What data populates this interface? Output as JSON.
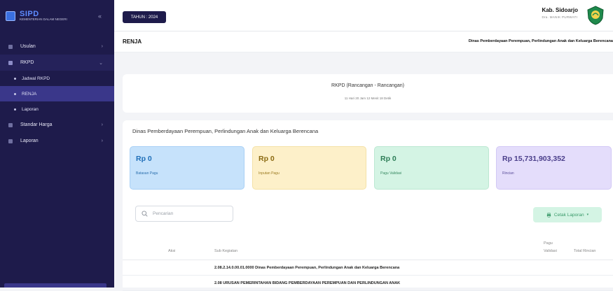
{
  "sidebar": {
    "brand_title": "SIPD",
    "brand_subtitle": "KEMENTERIAN DALAM NEGERI",
    "collapse_glyph": "«",
    "items": [
      {
        "label": "Usulan",
        "icon": "list-icon",
        "chevron": "›"
      },
      {
        "label": "RKPD",
        "icon": "folder-icon",
        "chevron": "⌄"
      },
      {
        "label": "Jadwal RKPD",
        "sub": true
      },
      {
        "label": "RENJA",
        "sub": true,
        "active": true
      },
      {
        "label": "Laporan",
        "sub": true
      },
      {
        "label": "Standar Harga",
        "icon": "tag-icon",
        "chevron": "›"
      },
      {
        "label": "Laporan",
        "icon": "report-icon",
        "chevron": "›"
      }
    ]
  },
  "topbar": {
    "year_label": "TAHUN : 2024",
    "region_name": "Kab. Sidoarjo",
    "user_name": "Dra. MANIK PURWATI"
  },
  "subbar": {
    "page_title": "RENJA",
    "department": "Dinas Pemberdayaan Perempuan, Perlindungan Anak dan Keluarga Berencana"
  },
  "timer": {
    "title": "RKPD (Rancangan - Rancangan)",
    "countdown": "11 Hari 20 Jam 12 Menit 18 Detik"
  },
  "main": {
    "title": "Dinas Pemberdayaan Perempuan, Perlindungan Anak dan Keluarga Berencana",
    "stats": [
      {
        "value": "Rp 0",
        "label": "Batasan Pagu"
      },
      {
        "value": "Rp 0",
        "label": "Inputan Pagu"
      },
      {
        "value": "Rp 0",
        "label": "Pagu Validasi"
      },
      {
        "value": "Rp 15,731,903,352",
        "label": "Rincian"
      }
    ],
    "search_placeholder": "Pencarian",
    "print_button": "Cetak Laporan",
    "table": {
      "headers": {
        "aksi": "Aksi",
        "sub_kegiatan": "Sub Kegiatan",
        "pagu_validasi": "Pagu Validasi",
        "total_rincian": "Total Rincian"
      },
      "rows": [
        "2.08.2.14.0.00.01.0000 Dinas Pemberdayaan Perempuan, Perlindungan Anak dan Keluarga Berencana",
        "2.08 URUSAN PEMERINTAHAN BIDANG PEMBERDAYAAN PEREMPUAN DAN PERLINDUNGAN ANAK"
      ]
    }
  },
  "colors": {
    "sidebar_bg": "#1e1b4b",
    "accent": "#3a378a",
    "stat_blue": "#c6e2fb",
    "stat_yellow": "#fdf0c9",
    "stat_green": "#d4f4e4",
    "stat_purple": "#e4ddfb"
  }
}
